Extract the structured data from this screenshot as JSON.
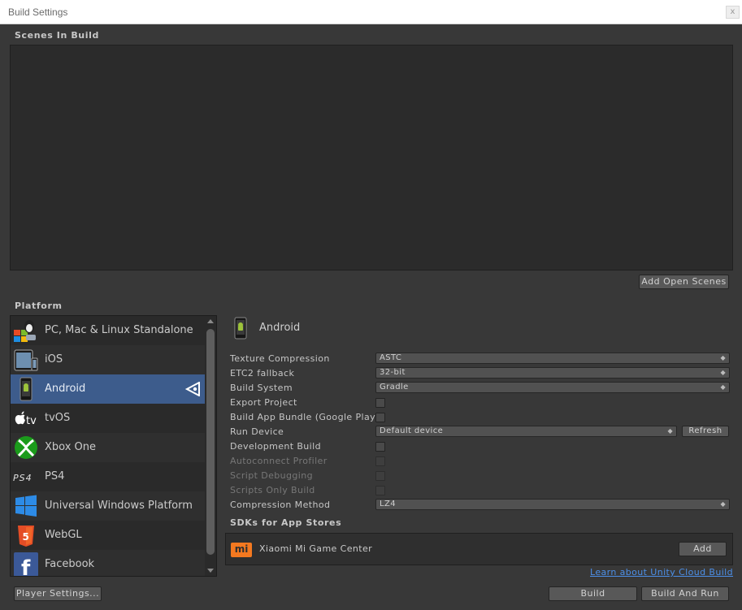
{
  "window": {
    "title": "Build Settings",
    "close": "x"
  },
  "scenes": {
    "title": "Scenes In Build",
    "add_open_scenes": "Add Open Scenes"
  },
  "platform": {
    "title": "Platform",
    "items": [
      {
        "label": "PC, Mac & Linux Standalone",
        "icon": "pc-mac-linux-icon"
      },
      {
        "label": "iOS",
        "icon": "ios-device-icon"
      },
      {
        "label": "Android",
        "icon": "android-phone-icon"
      },
      {
        "label": "tvOS",
        "icon": "apple-tv-icon"
      },
      {
        "label": "Xbox One",
        "icon": "xbox-icon"
      },
      {
        "label": "PS4",
        "icon": "ps4-logo-icon"
      },
      {
        "label": "Universal Windows Platform",
        "icon": "windows-logo-icon"
      },
      {
        "label": "WebGL",
        "icon": "html5-icon"
      },
      {
        "label": "Facebook",
        "icon": "facebook-icon"
      }
    ],
    "selected": "Android"
  },
  "settings": {
    "header": "Android",
    "texture_compression": {
      "label": "Texture Compression",
      "value": "ASTC"
    },
    "etc2_fallback": {
      "label": "ETC2 fallback",
      "value": "32-bit"
    },
    "build_system": {
      "label": "Build System",
      "value": "Gradle"
    },
    "export_project": {
      "label": "Export Project"
    },
    "build_app_bundle": {
      "label": "Build App Bundle (Google Play)"
    },
    "run_device": {
      "label": "Run Device",
      "value": "Default device",
      "refresh": "Refresh"
    },
    "development_build": {
      "label": "Development Build"
    },
    "autoconnect_profiler": {
      "label": "Autoconnect Profiler"
    },
    "script_debugging": {
      "label": "Script Debugging"
    },
    "scripts_only_build": {
      "label": "Scripts Only Build"
    },
    "compression_method": {
      "label": "Compression Method",
      "value": "LZ4"
    }
  },
  "sdks": {
    "title": "SDKs for App Stores",
    "items": [
      {
        "label": "Xiaomi Mi Game Center",
        "button": "Add",
        "icon_text": "mi"
      }
    ]
  },
  "footer": {
    "cloud_link": "Learn about Unity Cloud Build",
    "player_settings": "Player Settings...",
    "build": "Build",
    "build_and_run": "Build And Run"
  },
  "colors": {
    "selection": "#3d5c8c",
    "link": "#4c8fe8",
    "panel": "#383838"
  }
}
